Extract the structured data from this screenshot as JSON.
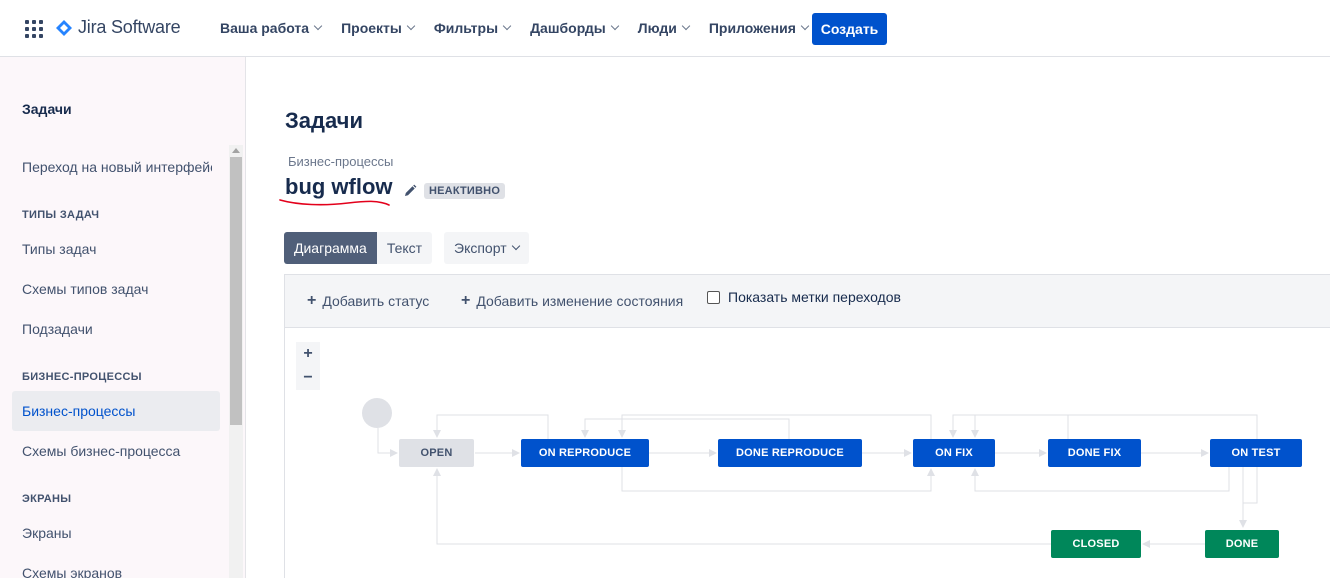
{
  "header": {
    "product": "Jira Software",
    "nav": [
      "Ваша работа",
      "Проекты",
      "Фильтры",
      "Дашборды",
      "Люди",
      "Приложения"
    ],
    "create_label": "Создать"
  },
  "sidebar": {
    "title": "Задачи",
    "new_ui_link": "Переход на новый интерфейс",
    "sections": {
      "issue_types": "ТИПЫ ЗАДАЧ",
      "workflows": "БИЗНЕС-ПРОЦЕССЫ",
      "screens": "ЭКРАНЫ"
    },
    "items": {
      "issue_types": "Типы задач",
      "issue_type_schemes": "Схемы типов задач",
      "subtasks": "Подзадачи",
      "workflows": "Бизнес-процессы",
      "workflow_schemes": "Схемы бизнес-процесса",
      "screens": "Экраны",
      "screen_schemes": "Схемы экранов"
    }
  },
  "main": {
    "title": "Задачи",
    "breadcrumb": "Бизнес-процессы",
    "workflow_name": "bug wflow",
    "status": "НЕАКТИВНО",
    "tabs": [
      "Диаграмма",
      "Текст"
    ],
    "export_label": "Экспорт",
    "toolbar": {
      "add_status": "Добавить статус",
      "add_transition": "Добавить изменение состояния",
      "show_labels": "Показать метки переходов",
      "show_labels_checked": false
    },
    "zoom_in": "+",
    "zoom_out": "−"
  },
  "diagram": {
    "statuses": {
      "open": "OPEN",
      "on_reproduce": "ON REPRODUCE",
      "done_reproduce": "DONE REPRODUCE",
      "on_fix": "ON FIX",
      "done_fix": "DONE FIX",
      "on_test": "ON TEST",
      "closed": "CLOSED",
      "done": "DONE"
    }
  },
  "colors": {
    "primary": "#0052cc",
    "in_progress": "#0052cc",
    "done": "#00875a",
    "todo": "#dfe1e6",
    "annotation": "#e3001b"
  }
}
